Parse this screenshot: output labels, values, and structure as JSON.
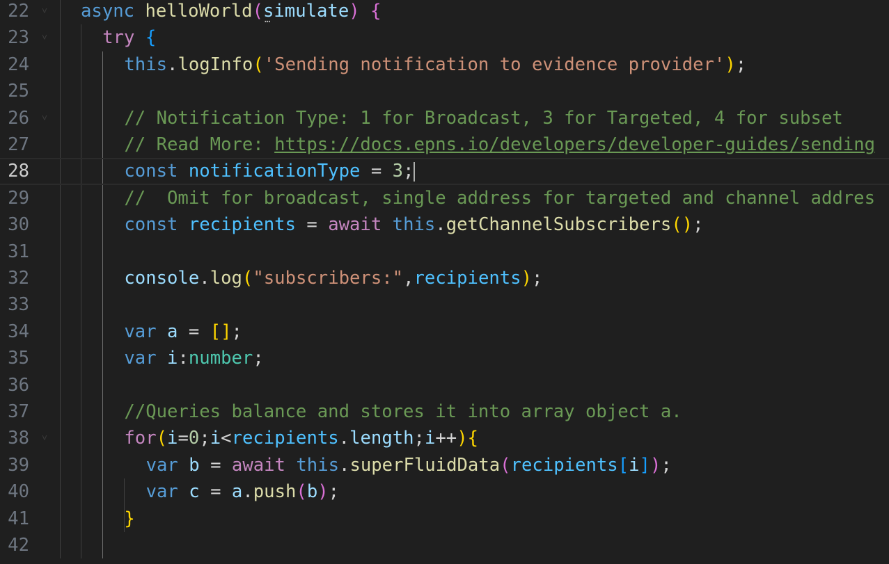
{
  "colors": {
    "background": "#1f1f1f",
    "line_number": "#6e7681",
    "line_number_active": "#cccccc",
    "keyword_blue": "#569cd6",
    "control_purple": "#c586c0",
    "function_yellow": "#dcdcaa",
    "variable_light": "#9cdcfe",
    "constant_blue": "#4fc1ff",
    "type_teal": "#4ec9b0",
    "string_orange": "#ce9178",
    "number_green": "#b5cea8",
    "comment_green": "#6a9955",
    "bracket_gold": "#ffd700",
    "bracket_pink": "#da70d6",
    "bracket_blue": "#179fff",
    "plain": "#d4d4d4"
  },
  "icons": {
    "fold": "chevron-down-icon",
    "parameter_hint": "ellipsis-icon"
  },
  "editor": {
    "active_line": 28,
    "lines": [
      {
        "num": "22",
        "fold": true,
        "indent": 0,
        "tokens": [
          {
            "t": "async",
            "c": "#569cd6"
          },
          {
            "t": " ",
            "c": "#d4d4d4"
          },
          {
            "t": "helloWorld",
            "c": "#dcdcaa"
          },
          {
            "t": "(",
            "c": "#da70d6"
          },
          {
            "t": "simulate",
            "c": "#9cdcfe"
          },
          {
            "t": ")",
            "c": "#da70d6"
          },
          {
            "t": " ",
            "c": "#d4d4d4"
          },
          {
            "t": "{",
            "c": "#da70d6"
          }
        ]
      },
      {
        "num": "23",
        "fold": true,
        "indent": 1,
        "tokens": [
          {
            "t": "try",
            "c": "#c586c0"
          },
          {
            "t": " ",
            "c": "#d4d4d4"
          },
          {
            "t": "{",
            "c": "#179fff"
          }
        ]
      },
      {
        "num": "24",
        "fold": false,
        "indent": 2,
        "tokens": [
          {
            "t": "this",
            "c": "#569cd6"
          },
          {
            "t": ".",
            "c": "#d4d4d4"
          },
          {
            "t": "logInfo",
            "c": "#dcdcaa"
          },
          {
            "t": "(",
            "c": "#ffd700"
          },
          {
            "t": "'Sending notification to evidence provider'",
            "c": "#ce9178"
          },
          {
            "t": ")",
            "c": "#ffd700"
          },
          {
            "t": ";",
            "c": "#d4d4d4"
          }
        ]
      },
      {
        "num": "25",
        "fold": false,
        "indent": 2,
        "tokens": []
      },
      {
        "num": "26",
        "fold": true,
        "indent": 2,
        "tokens": [
          {
            "t": "// Notification Type: 1 for Broadcast, 3 for Targeted, 4 for subset",
            "c": "#6a9955"
          }
        ]
      },
      {
        "num": "27",
        "fold": false,
        "indent": 2,
        "tokens": [
          {
            "t": "// Read More: ",
            "c": "#6a9955"
          },
          {
            "t": "https://docs.epns.io/developers/developer-guides/sending",
            "c": "#6a9955",
            "u": true
          }
        ]
      },
      {
        "num": "28",
        "fold": false,
        "indent": 2,
        "cursor": true,
        "tokens": [
          {
            "t": "const",
            "c": "#569cd6"
          },
          {
            "t": " ",
            "c": "#d4d4d4"
          },
          {
            "t": "notificationType",
            "c": "#4fc1ff"
          },
          {
            "t": " = ",
            "c": "#d4d4d4"
          },
          {
            "t": "3",
            "c": "#b5cea8"
          },
          {
            "t": ";",
            "c": "#d4d4d4"
          }
        ]
      },
      {
        "num": "29",
        "fold": false,
        "indent": 2,
        "tokens": [
          {
            "t": "//  Omit for broadcast, single address for targeted and channel addres",
            "c": "#6a9955"
          }
        ]
      },
      {
        "num": "30",
        "fold": false,
        "indent": 2,
        "tokens": [
          {
            "t": "const",
            "c": "#569cd6"
          },
          {
            "t": " ",
            "c": "#d4d4d4"
          },
          {
            "t": "recipients",
            "c": "#4fc1ff"
          },
          {
            "t": " = ",
            "c": "#d4d4d4"
          },
          {
            "t": "await",
            "c": "#c586c0"
          },
          {
            "t": " ",
            "c": "#d4d4d4"
          },
          {
            "t": "this",
            "c": "#569cd6"
          },
          {
            "t": ".",
            "c": "#d4d4d4"
          },
          {
            "t": "getChannelSubscribers",
            "c": "#dcdcaa"
          },
          {
            "t": "()",
            "c": "#ffd700"
          },
          {
            "t": ";",
            "c": "#d4d4d4"
          }
        ]
      },
      {
        "num": "31",
        "fold": false,
        "indent": 2,
        "tokens": []
      },
      {
        "num": "32",
        "fold": false,
        "indent": 2,
        "tokens": [
          {
            "t": "console",
            "c": "#9cdcfe"
          },
          {
            "t": ".",
            "c": "#d4d4d4"
          },
          {
            "t": "log",
            "c": "#dcdcaa"
          },
          {
            "t": "(",
            "c": "#ffd700"
          },
          {
            "t": "\"subscribers:\"",
            "c": "#ce9178"
          },
          {
            "t": ",",
            "c": "#d4d4d4"
          },
          {
            "t": "recipients",
            "c": "#4fc1ff"
          },
          {
            "t": ")",
            "c": "#ffd700"
          },
          {
            "t": ";",
            "c": "#d4d4d4"
          }
        ]
      },
      {
        "num": "33",
        "fold": false,
        "indent": 2,
        "tokens": []
      },
      {
        "num": "34",
        "fold": false,
        "indent": 2,
        "tokens": [
          {
            "t": "var",
            "c": "#569cd6"
          },
          {
            "t": " ",
            "c": "#d4d4d4"
          },
          {
            "t": "a",
            "c": "#9cdcfe"
          },
          {
            "t": " = ",
            "c": "#d4d4d4"
          },
          {
            "t": "[]",
            "c": "#ffd700"
          },
          {
            "t": ";",
            "c": "#d4d4d4"
          }
        ]
      },
      {
        "num": "35",
        "fold": false,
        "indent": 2,
        "tokens": [
          {
            "t": "var",
            "c": "#569cd6"
          },
          {
            "t": " ",
            "c": "#d4d4d4"
          },
          {
            "t": "i",
            "c": "#9cdcfe"
          },
          {
            "t": ":",
            "c": "#d4d4d4"
          },
          {
            "t": "number",
            "c": "#4ec9b0"
          },
          {
            "t": ";",
            "c": "#d4d4d4"
          }
        ]
      },
      {
        "num": "36",
        "fold": false,
        "indent": 2,
        "tokens": []
      },
      {
        "num": "37",
        "fold": false,
        "indent": 2,
        "tokens": [
          {
            "t": "//Queries balance and stores it into array object a.",
            "c": "#6a9955"
          }
        ]
      },
      {
        "num": "38",
        "fold": true,
        "indent": 2,
        "tokens": [
          {
            "t": "for",
            "c": "#c586c0"
          },
          {
            "t": "(",
            "c": "#ffd700"
          },
          {
            "t": "i",
            "c": "#9cdcfe"
          },
          {
            "t": "=",
            "c": "#d4d4d4"
          },
          {
            "t": "0",
            "c": "#b5cea8"
          },
          {
            "t": ";",
            "c": "#d4d4d4"
          },
          {
            "t": "i",
            "c": "#9cdcfe"
          },
          {
            "t": "<",
            "c": "#d4d4d4"
          },
          {
            "t": "recipients",
            "c": "#4fc1ff"
          },
          {
            "t": ".",
            "c": "#d4d4d4"
          },
          {
            "t": "length",
            "c": "#9cdcfe"
          },
          {
            "t": ";",
            "c": "#d4d4d4"
          },
          {
            "t": "i",
            "c": "#9cdcfe"
          },
          {
            "t": "++",
            "c": "#d4d4d4"
          },
          {
            "t": ")",
            "c": "#ffd700"
          },
          {
            "t": "{",
            "c": "#ffd700"
          }
        ]
      },
      {
        "num": "39",
        "fold": false,
        "indent": 3,
        "tokens": [
          {
            "t": "var",
            "c": "#569cd6"
          },
          {
            "t": " ",
            "c": "#d4d4d4"
          },
          {
            "t": "b",
            "c": "#9cdcfe"
          },
          {
            "t": " = ",
            "c": "#d4d4d4"
          },
          {
            "t": "await",
            "c": "#c586c0"
          },
          {
            "t": " ",
            "c": "#d4d4d4"
          },
          {
            "t": "this",
            "c": "#569cd6"
          },
          {
            "t": ".",
            "c": "#d4d4d4"
          },
          {
            "t": "superFluidData",
            "c": "#dcdcaa"
          },
          {
            "t": "(",
            "c": "#da70d6"
          },
          {
            "t": "recipients",
            "c": "#4fc1ff"
          },
          {
            "t": "[",
            "c": "#179fff"
          },
          {
            "t": "i",
            "c": "#9cdcfe"
          },
          {
            "t": "]",
            "c": "#179fff"
          },
          {
            "t": ")",
            "c": "#da70d6"
          },
          {
            "t": ";",
            "c": "#d4d4d4"
          }
        ]
      },
      {
        "num": "40",
        "fold": false,
        "indent": 3,
        "tokens": [
          {
            "t": "var",
            "c": "#569cd6"
          },
          {
            "t": " ",
            "c": "#d4d4d4"
          },
          {
            "t": "c",
            "c": "#9cdcfe"
          },
          {
            "t": " = ",
            "c": "#d4d4d4"
          },
          {
            "t": "a",
            "c": "#9cdcfe"
          },
          {
            "t": ".",
            "c": "#d4d4d4"
          },
          {
            "t": "push",
            "c": "#dcdcaa"
          },
          {
            "t": "(",
            "c": "#da70d6"
          },
          {
            "t": "b",
            "c": "#9cdcfe"
          },
          {
            "t": ")",
            "c": "#da70d6"
          },
          {
            "t": ";",
            "c": "#d4d4d4"
          }
        ]
      },
      {
        "num": "41",
        "fold": false,
        "indent": 2,
        "tokens": [
          {
            "t": "}",
            "c": "#ffd700"
          }
        ]
      },
      {
        "num": "42",
        "fold": false,
        "indent": 2,
        "tokens": []
      }
    ]
  }
}
